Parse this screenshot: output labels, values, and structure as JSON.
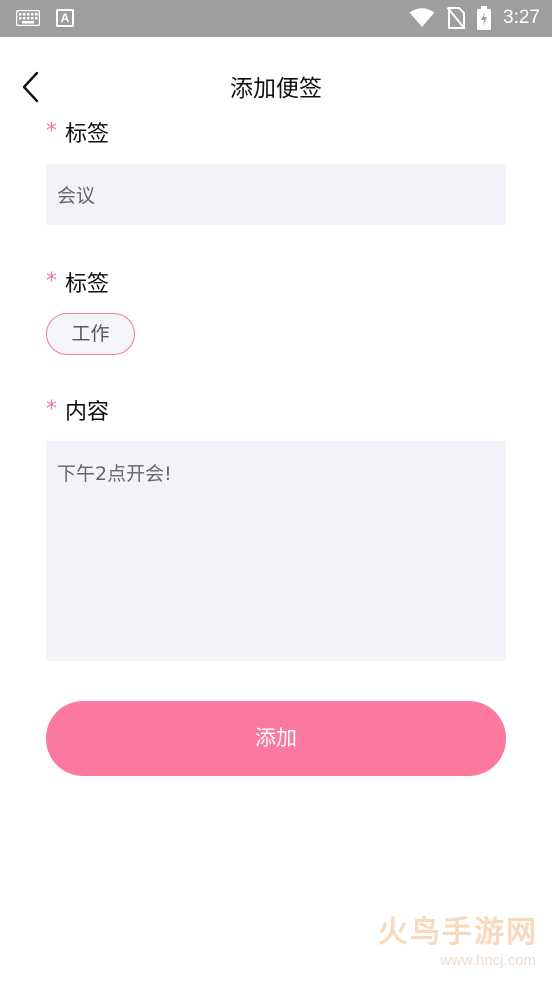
{
  "status_bar": {
    "time": "3:27",
    "input_indicator": "A",
    "icons": [
      "keyboard-icon",
      "a-input-icon",
      "wifi-icon",
      "no-sim-icon",
      "battery-charging-icon"
    ]
  },
  "header": {
    "title": "添加便签",
    "back_icon": "chevron-left-icon"
  },
  "form": {
    "required_mark": "*",
    "title_field": {
      "label": "标签",
      "value": "会议"
    },
    "tag_field": {
      "label": "标签",
      "selected_tag": "工作"
    },
    "content_field": {
      "label": "内容",
      "value": "下午2点开会!"
    },
    "submit_label": "添加"
  },
  "watermark": {
    "main": "火鸟手游网",
    "sub": "www.hncj.com"
  },
  "colors": {
    "accent": "#fb799f",
    "required": "#f27a9e",
    "input_bg": "#f2f3f8",
    "statusbar_bg": "#9e9e9e"
  }
}
